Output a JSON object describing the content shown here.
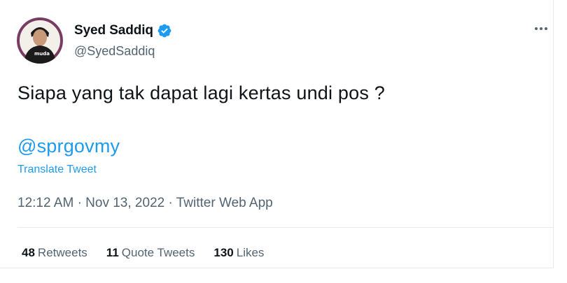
{
  "author": {
    "display_name": "Syed Saddiq",
    "handle": "@SyedSaddiq",
    "shirt_text": "muda"
  },
  "tweet": {
    "text": "Siapa yang tak dapat lagi kertas undi pos ?",
    "mention": "@sprgovmy",
    "translate_label": "Translate Tweet",
    "time": "12:12 AM",
    "separator": "·",
    "date": "Nov 13, 2022",
    "source": "Twitter Web App"
  },
  "stats": {
    "retweets_count": "48",
    "retweets_label": "Retweets",
    "quotes_count": "11",
    "quotes_label": "Quote Tweets",
    "likes_count": "130",
    "likes_label": "Likes"
  },
  "icons": {
    "verified": "verified-badge-icon",
    "more": "more-options-icon"
  },
  "colors": {
    "accent": "#1d9bf0",
    "secondary_text": "#536471",
    "primary_text": "#0f1419",
    "divider": "#e6ecf0",
    "avatar_bg": "#7a3b63"
  }
}
